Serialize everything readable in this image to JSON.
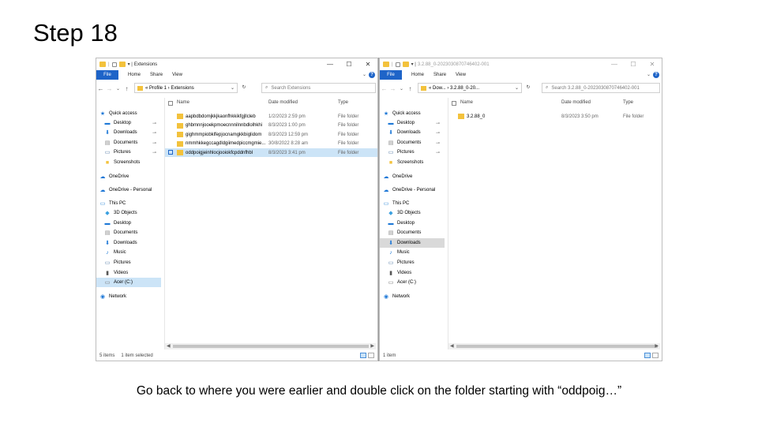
{
  "step_title": "Step 18",
  "caption": "Go back to where you were earlier and double click on the folder starting with “oddpoig…”",
  "left_window": {
    "title": "Extensions",
    "ribbon": {
      "file": "File",
      "tabs": [
        "Home",
        "Share",
        "View"
      ]
    },
    "address": "« Profile 1 › Extensions",
    "search_placeholder": "Search Extensions",
    "nav_items": [
      {
        "label": "Quick access",
        "icon": "star-icon"
      },
      {
        "label": "Desktop",
        "icon": "desktop-icon",
        "pinned": true
      },
      {
        "label": "Downloads",
        "icon": "download-icon",
        "pinned": true
      },
      {
        "label": "Documents",
        "icon": "documents-icon",
        "pinned": true
      },
      {
        "label": "Pictures",
        "icon": "pictures-icon",
        "pinned": true
      },
      {
        "label": "Screenshots",
        "icon": "folder-icon"
      },
      {
        "label": "OneDrive",
        "icon": "cloud-icon"
      },
      {
        "label": "OneDrive - Personal",
        "icon": "cloud-icon"
      },
      {
        "label": "This PC",
        "icon": "pc-icon"
      },
      {
        "label": "3D Objects",
        "icon": "cube-icon"
      },
      {
        "label": "Desktop",
        "icon": "desktop-icon"
      },
      {
        "label": "Documents",
        "icon": "documents-icon"
      },
      {
        "label": "Downloads",
        "icon": "download-icon"
      },
      {
        "label": "Music",
        "icon": "music-icon"
      },
      {
        "label": "Pictures",
        "icon": "pictures-icon"
      },
      {
        "label": "Videos",
        "icon": "video-icon"
      },
      {
        "label": "Acer (C:)",
        "icon": "drive-icon"
      },
      {
        "label": "Network",
        "icon": "network-icon"
      }
    ],
    "columns": {
      "name": "Name",
      "date": "Date modified",
      "type": "Type"
    },
    "rows": [
      {
        "name": "aapbdbdomjkkjkaonfhkkikfgjllcleb",
        "date": "1/2/2023 2:59 pm",
        "type": "File folder"
      },
      {
        "name": "ghbmnnjooekpmoecnnnilnnbdlolhkhi",
        "date": "8/3/2023 1:00 pm",
        "type": "File folder"
      },
      {
        "name": "gighmmpiobklfepjocnamgkkbiglidom",
        "date": "8/3/2023 12:59 pm",
        "type": "File folder"
      },
      {
        "name": "nmmhkkegccagdldgiimedpiccmgmie...",
        "date": "30/8/2022 8:28 am",
        "type": "File folder"
      },
      {
        "name": "oddpoigjeinhlocjooiokfcpddnfhbl",
        "date": "8/3/2023 3:41 pm",
        "type": "File folder"
      }
    ],
    "status_items": "5 items",
    "status_selected": "1 item selected"
  },
  "right_window": {
    "title": "3.2.88_0-2023030870746402-001",
    "ribbon": {
      "file": "File",
      "tabs": [
        "Home",
        "Share",
        "View"
      ]
    },
    "address": "« Dow... › 3.2.88_0-20...",
    "search_placeholder": "Search 3.2.88_0-2023030870746402-001",
    "nav_items": [
      {
        "label": "Quick access",
        "icon": "star-icon"
      },
      {
        "label": "Desktop",
        "icon": "desktop-icon",
        "pinned": true
      },
      {
        "label": "Downloads",
        "icon": "download-icon",
        "pinned": true
      },
      {
        "label": "Documents",
        "icon": "documents-icon",
        "pinned": true
      },
      {
        "label": "Pictures",
        "icon": "pictures-icon",
        "pinned": true
      },
      {
        "label": "Screenshots",
        "icon": "folder-icon"
      },
      {
        "label": "OneDrive",
        "icon": "cloud-icon"
      },
      {
        "label": "OneDrive - Personal",
        "icon": "cloud-icon"
      },
      {
        "label": "This PC",
        "icon": "pc-icon"
      },
      {
        "label": "3D Objects",
        "icon": "cube-icon"
      },
      {
        "label": "Desktop",
        "icon": "desktop-icon"
      },
      {
        "label": "Documents",
        "icon": "documents-icon"
      },
      {
        "label": "Downloads",
        "icon": "download-icon"
      },
      {
        "label": "Music",
        "icon": "music-icon"
      },
      {
        "label": "Pictures",
        "icon": "pictures-icon"
      },
      {
        "label": "Videos",
        "icon": "video-icon"
      },
      {
        "label": "Acer (C:)",
        "icon": "drive-icon"
      },
      {
        "label": "Network",
        "icon": "network-icon"
      }
    ],
    "columns": {
      "name": "Name",
      "date": "Date modified",
      "type": "Type"
    },
    "rows": [
      {
        "name": "3.2.88_0",
        "date": "8/3/2023 3:50 pm",
        "type": "File folder"
      }
    ],
    "status_items": "1 item"
  }
}
